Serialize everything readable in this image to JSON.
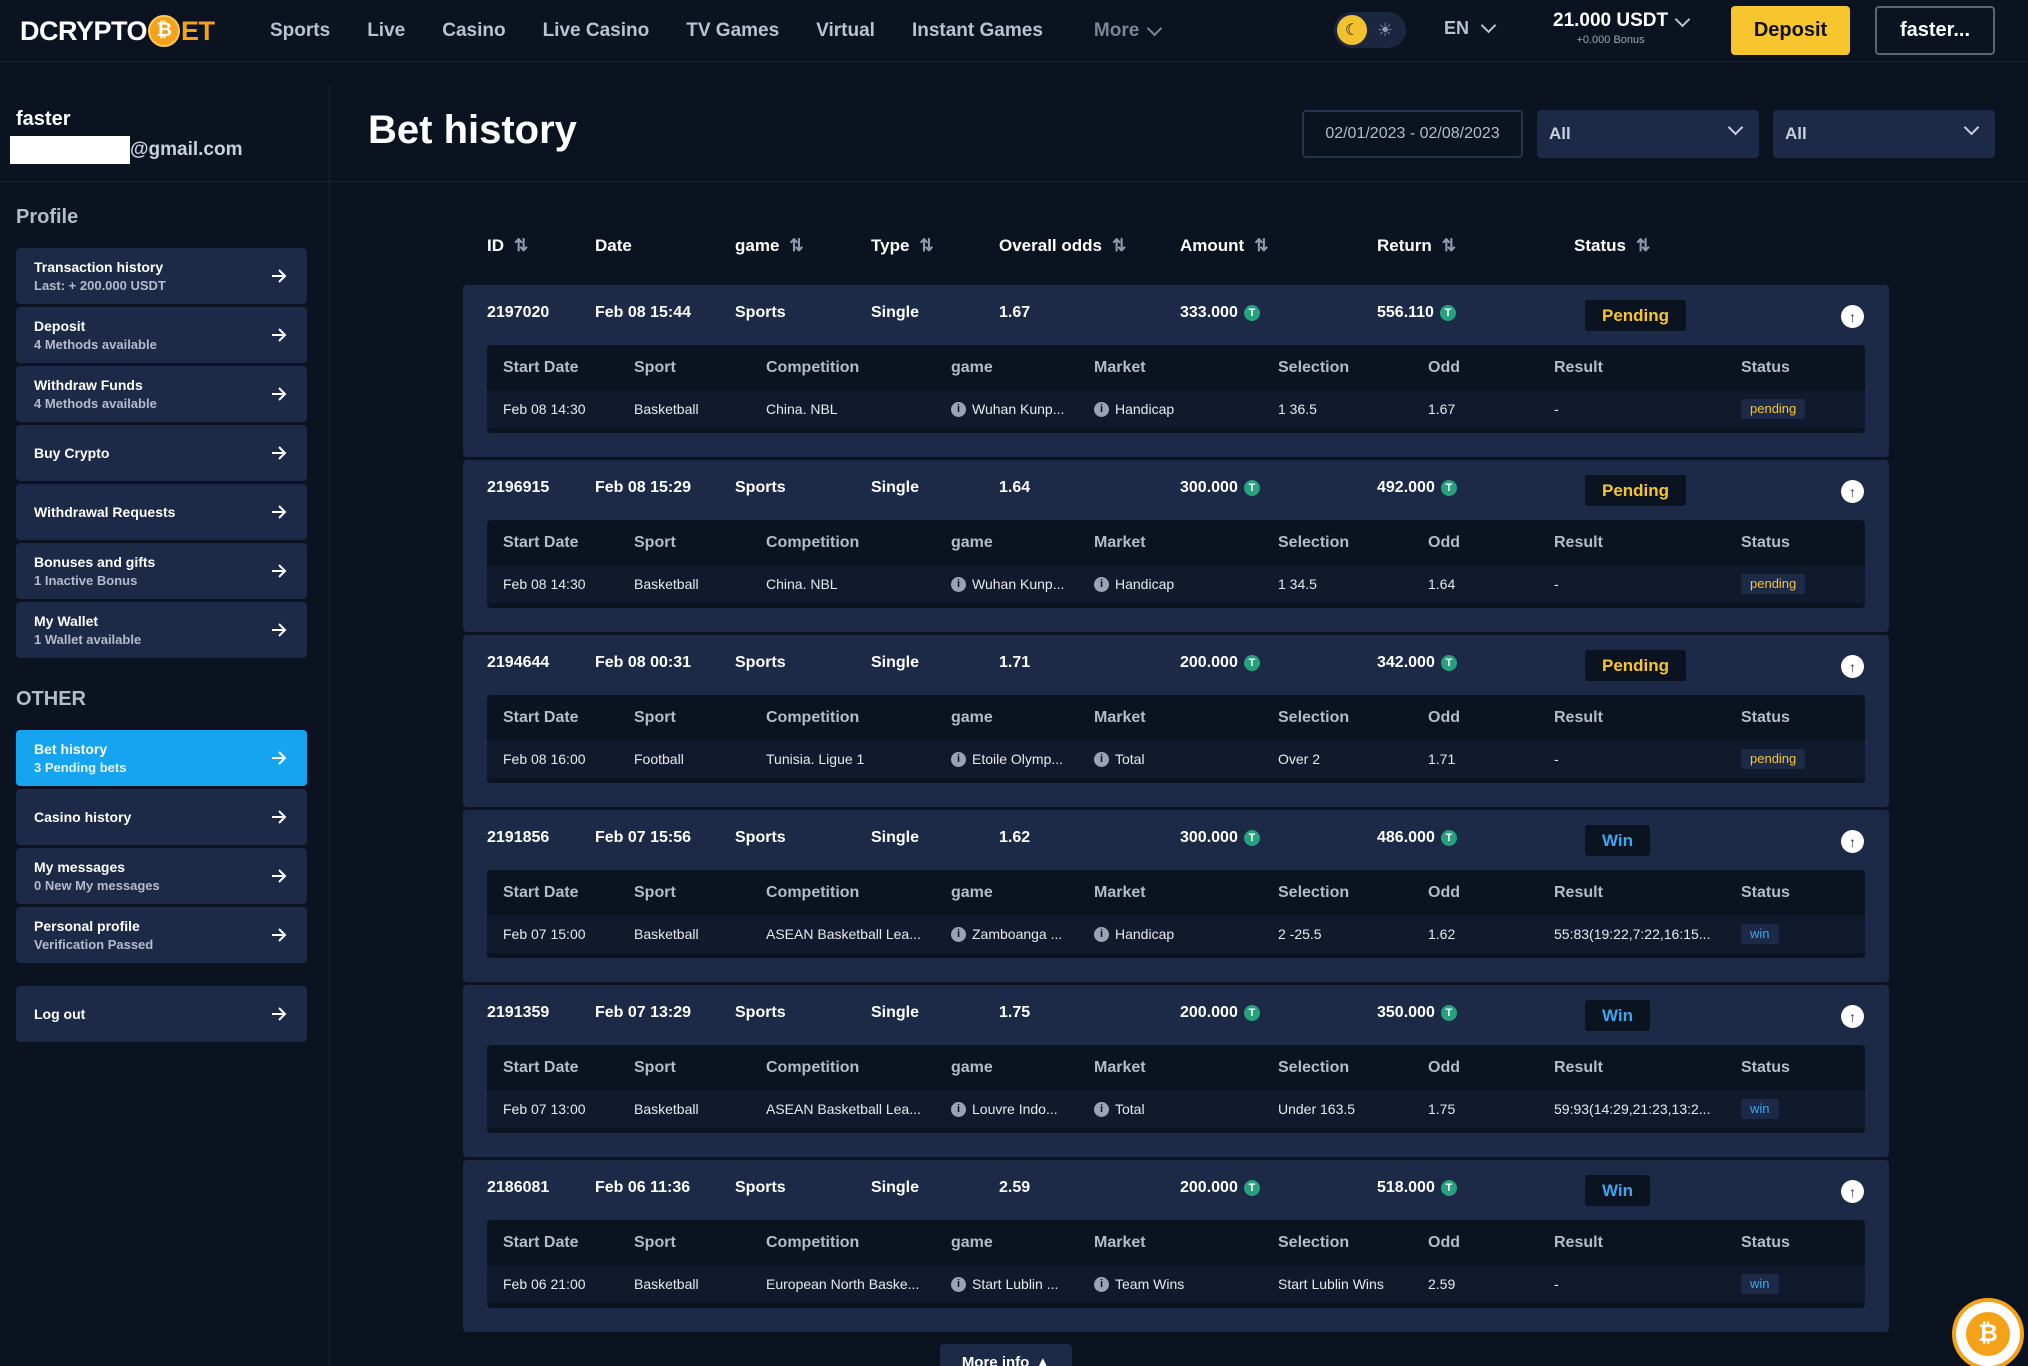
{
  "header": {
    "logo": {
      "part1": "D",
      "part2": "CRYPTO",
      "coin": "₿",
      "part3": "ET"
    },
    "nav": [
      "Sports",
      "Live",
      "Casino",
      "Live Casino",
      "TV Games",
      "Virtual",
      "Instant Games"
    ],
    "more_label": "More",
    "theme_icons": {
      "moon": "☾",
      "sun": "☀"
    },
    "language": "EN",
    "balance": "21.000 USDT",
    "bonus": "+0.000 Bonus",
    "deposit_label": "Deposit",
    "user_label": "faster..."
  },
  "sidebar": {
    "username": "faster",
    "email_suffix": "@gmail.com",
    "profile_title": "Profile",
    "profile_items": [
      {
        "title": "Transaction history",
        "sub": "Last: + 200.000 USDT"
      },
      {
        "title": "Deposit",
        "sub": "4 Methods available"
      },
      {
        "title": "Withdraw Funds",
        "sub": "4 Methods available"
      },
      {
        "title": "Buy Crypto",
        "sub": ""
      },
      {
        "title": "Withdrawal Requests",
        "sub": ""
      },
      {
        "title": "Bonuses and gifts",
        "sub": "1 Inactive Bonus"
      },
      {
        "title": "My Wallet",
        "sub": "1 Wallet available"
      }
    ],
    "other_title": "OTHER",
    "other_items": [
      {
        "title": "Bet history",
        "sub": "3 Pending bets",
        "active": true
      },
      {
        "title": "Casino history",
        "sub": ""
      },
      {
        "title": "My messages",
        "sub": "0 New My messages"
      },
      {
        "title": "Personal profile",
        "sub": "Verification Passed"
      }
    ],
    "logout": "Log out"
  },
  "main": {
    "title": "Bet history",
    "date_range": "02/01/2023 - 02/08/2023",
    "filter1": "All",
    "filter2": "All",
    "columns": [
      "ID",
      "Date",
      "game",
      "Type",
      "Overall odds",
      "Amount",
      "Return",
      "Status"
    ],
    "sort_icon": "⇅",
    "currency_icon": "T",
    "detail_columns": [
      "Start Date",
      "Sport",
      "Competition",
      "game",
      "Market",
      "Selection",
      "Odd",
      "Result",
      "Status"
    ],
    "bets": [
      {
        "id": "2197020",
        "date": "Feb 08 15:44",
        "game": "Sports",
        "type": "Single",
        "odds": "1.67",
        "amount": "333.000",
        "return": "556.110",
        "status": "Pending",
        "status_kind": "pending",
        "detail": {
          "start": "Feb 08 14:30",
          "sport": "Basketball",
          "competition": "China. NBL",
          "game": "Wuhan Kunp...",
          "market": "Handicap",
          "selection": "1 36.5",
          "odd": "1.67",
          "result": "-",
          "status": "pending"
        }
      },
      {
        "id": "2196915",
        "date": "Feb 08 15:29",
        "game": "Sports",
        "type": "Single",
        "odds": "1.64",
        "amount": "300.000",
        "return": "492.000",
        "status": "Pending",
        "status_kind": "pending",
        "detail": {
          "start": "Feb 08 14:30",
          "sport": "Basketball",
          "competition": "China. NBL",
          "game": "Wuhan Kunp...",
          "market": "Handicap",
          "selection": "1 34.5",
          "odd": "1.64",
          "result": "-",
          "status": "pending"
        }
      },
      {
        "id": "2194644",
        "date": "Feb 08 00:31",
        "game": "Sports",
        "type": "Single",
        "odds": "1.71",
        "amount": "200.000",
        "return": "342.000",
        "status": "Pending",
        "status_kind": "pending",
        "detail": {
          "start": "Feb 08 16:00",
          "sport": "Football",
          "competition": "Tunisia. Ligue 1",
          "game": "Etoile Olymp...",
          "market": "Total",
          "selection": "Over 2",
          "odd": "1.71",
          "result": "-",
          "status": "pending"
        }
      },
      {
        "id": "2191856",
        "date": "Feb 07 15:56",
        "game": "Sports",
        "type": "Single",
        "odds": "1.62",
        "amount": "300.000",
        "return": "486.000",
        "status": "Win",
        "status_kind": "win",
        "detail": {
          "start": "Feb 07 15:00",
          "sport": "Basketball",
          "competition": "ASEAN Basketball Lea...",
          "game": "Zamboanga ...",
          "market": "Handicap",
          "selection": "2 -25.5",
          "odd": "1.62",
          "result": "55:83(19:22,7:22,16:15...",
          "status": "win"
        }
      },
      {
        "id": "2191359",
        "date": "Feb 07 13:29",
        "game": "Sports",
        "type": "Single",
        "odds": "1.75",
        "amount": "200.000",
        "return": "350.000",
        "status": "Win",
        "status_kind": "win",
        "detail": {
          "start": "Feb 07 13:00",
          "sport": "Basketball",
          "competition": "ASEAN Basketball Lea...",
          "game": "Louvre Indo...",
          "market": "Total",
          "selection": "Under 163.5",
          "odd": "1.75",
          "result": "59:93(14:29,21:23,13:2...",
          "status": "win"
        }
      },
      {
        "id": "2186081",
        "date": "Feb 06 11:36",
        "game": "Sports",
        "type": "Single",
        "odds": "2.59",
        "amount": "200.000",
        "return": "518.000",
        "status": "Win",
        "status_kind": "win",
        "detail": {
          "start": "Feb 06 21:00",
          "sport": "Basketball",
          "competition": "European North Baske...",
          "game": "Start Lublin ...",
          "market": "Team Wins",
          "selection": "Start Lublin Wins",
          "odd": "2.59",
          "result": "-",
          "status": "win"
        }
      }
    ],
    "more_info": "More info"
  },
  "colors": {
    "accent_yellow": "#f7c62f",
    "accent_blue": "#16a3f0",
    "win_blue": "#39a8f0",
    "panel": "#1c2a48",
    "bg": "#0b1220"
  }
}
